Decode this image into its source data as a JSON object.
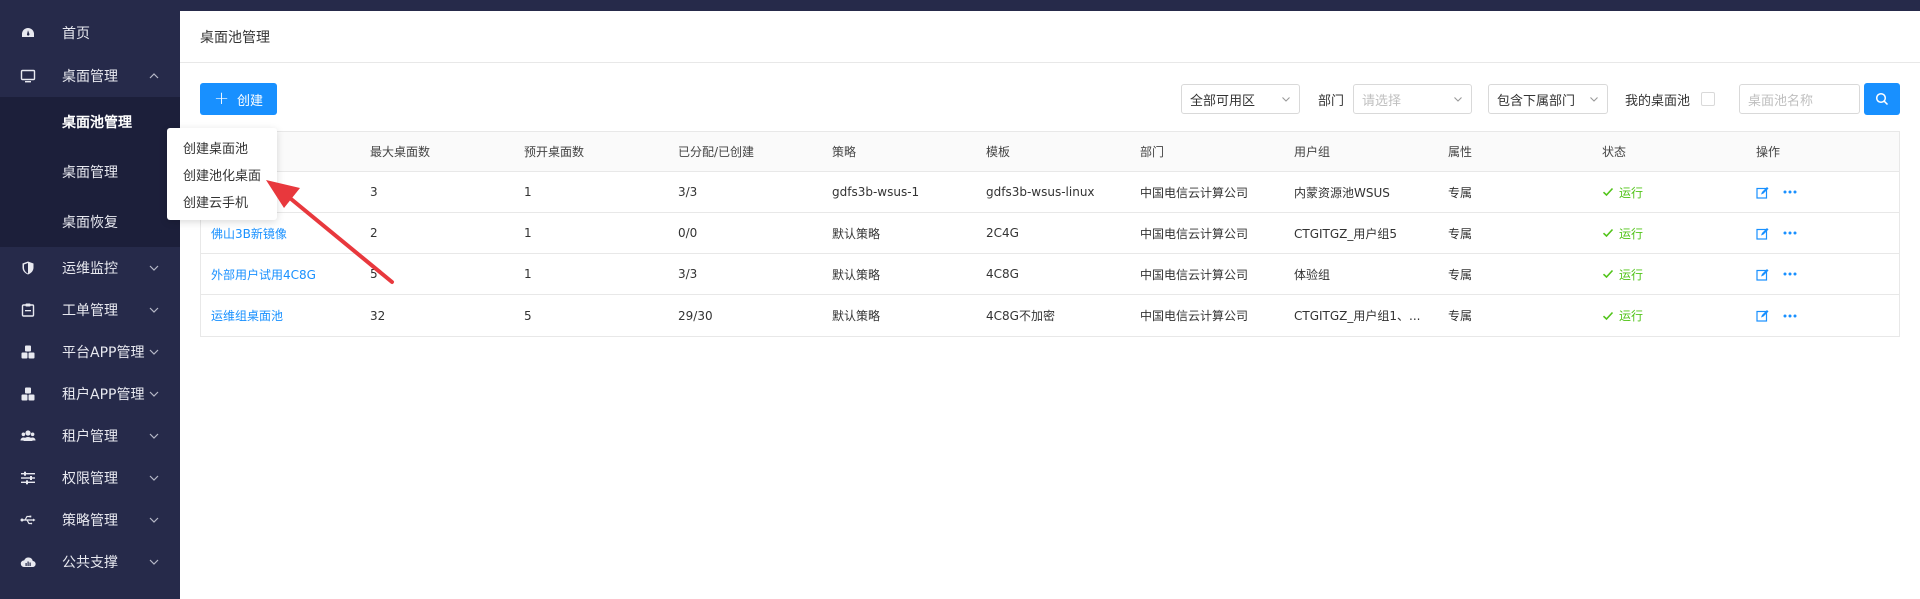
{
  "sidebar": {
    "items": [
      {
        "label": "首页",
        "icon": "dashboard-icon"
      },
      {
        "label": "桌面管理",
        "icon": "monitor-icon",
        "expanded": true,
        "children": [
          {
            "label": "桌面池管理",
            "active": true
          },
          {
            "label": "桌面管理"
          },
          {
            "label": "桌面恢复"
          }
        ]
      },
      {
        "label": "运维监控",
        "icon": "shield-icon"
      },
      {
        "label": "工单管理",
        "icon": "clipboard-icon"
      },
      {
        "label": "平台APP管理",
        "icon": "cubes-icon"
      },
      {
        "label": "租户APP管理",
        "icon": "cubes-icon"
      },
      {
        "label": "租户管理",
        "icon": "users-icon"
      },
      {
        "label": "权限管理",
        "icon": "sliders-icon"
      },
      {
        "label": "策略管理",
        "icon": "usb-icon"
      },
      {
        "label": "公共支撑",
        "icon": "cloud-chart-icon"
      }
    ]
  },
  "page": {
    "title": "桌面池管理"
  },
  "toolbar": {
    "create_label": "创建",
    "zone_select": "全部可用区",
    "dept_label": "部门",
    "dept_placeholder": "请选择",
    "include_sub_select": "包含下属部门",
    "my_pool_label": "我的桌面池",
    "search_placeholder": "桌面池名称"
  },
  "dropdown": {
    "items": [
      "创建桌面池",
      "创建池化桌面",
      "创建云手机"
    ]
  },
  "table": {
    "headers": [
      "",
      "最大桌面数",
      "预开桌面数",
      "已分配/已创建",
      "策略",
      "模板",
      "部门",
      "用户组",
      "属性",
      "状态",
      "操作"
    ],
    "rows": [
      {
        "name": "",
        "max": "3",
        "pre": "1",
        "alloc": "3/3",
        "policy": "gdfs3b-wsus-1",
        "template": "gdfs3b-wsus-linux",
        "dept": "中国电信云计算公司",
        "group": "内蒙资源池WSUS",
        "attr": "专属",
        "status": "运行"
      },
      {
        "name": "佛山3B新镜像",
        "max": "2",
        "pre": "1",
        "alloc": "0/0",
        "policy": "默认策略",
        "template": "2C4G",
        "dept": "中国电信云计算公司",
        "group": "CTGITGZ_用户组5",
        "attr": "专属",
        "status": "运行"
      },
      {
        "name": "外部用户试用4C8G",
        "max": "5",
        "pre": "1",
        "alloc": "3/3",
        "policy": "默认策略",
        "template": "4C8G",
        "dept": "中国电信云计算公司",
        "group": "体验组",
        "attr": "专属",
        "status": "运行"
      },
      {
        "name": "运维组桌面池",
        "max": "32",
        "pre": "5",
        "alloc": "29/30",
        "policy": "默认策略",
        "template": "4C8G不加密",
        "dept": "中国电信云计算公司",
        "group": "CTGITGZ_用户组1、...",
        "attr": "专属",
        "status": "运行"
      }
    ]
  },
  "colors": {
    "sidebar_bg": "#262a4a",
    "primary": "#1890ff",
    "success": "#52c41a",
    "annotation": "#e8383d"
  }
}
